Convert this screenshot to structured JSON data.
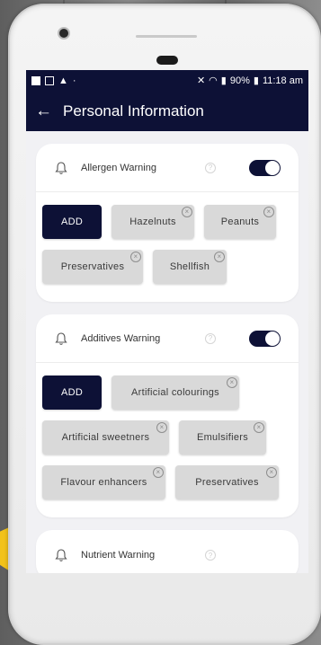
{
  "statusbar": {
    "battery": "90%",
    "time": "11:18 am"
  },
  "appbar": {
    "title": "Personal Information"
  },
  "cards": {
    "allergen": {
      "title": "Allergen Warning",
      "help": "?",
      "enabled": true,
      "add_label": "ADD",
      "chips": [
        "Hazelnuts",
        "Peanuts",
        "Preservatives",
        "Shellfish"
      ]
    },
    "additives": {
      "title": "Additives Warning",
      "help": "?",
      "enabled": true,
      "add_label": "ADD",
      "chips": [
        "Artificial colourings",
        "Artificial sweetners",
        "Emulsifiers",
        "Flavour enhancers",
        "Preservatives"
      ]
    },
    "nutrient": {
      "title": "Nutrient Warning",
      "help": "?"
    }
  },
  "colors": {
    "primary": "#0d1136",
    "chip": "#d9d9d9",
    "accent_arrow": "#f2c21a"
  }
}
